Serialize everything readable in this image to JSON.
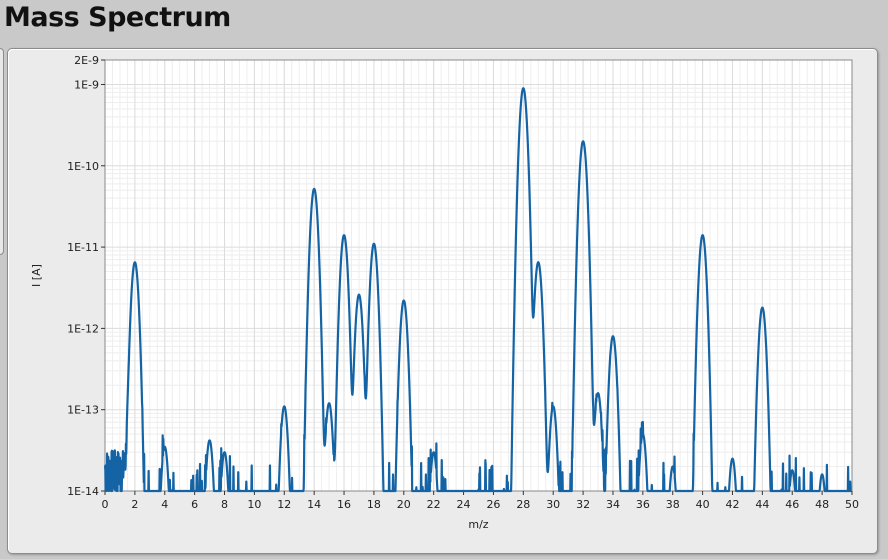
{
  "page": {
    "title": "Mass Spectrum"
  },
  "colors": {
    "trace": "#1463a5",
    "plot_bg": "#ffffff",
    "grid_major": "#dcdcdc",
    "grid_minor": "#eeeeee",
    "panel": "#ebebeb"
  },
  "chart_data": {
    "type": "line",
    "xlabel": "m/z",
    "ylabel": "I [A]",
    "xlim": [
      0,
      50
    ],
    "ylim": [
      1e-14,
      2e-09
    ],
    "y_scale": "log",
    "grid": true,
    "x_ticks": [
      0,
      2,
      4,
      6,
      8,
      10,
      12,
      14,
      16,
      18,
      20,
      22,
      24,
      26,
      28,
      30,
      32,
      34,
      36,
      38,
      40,
      42,
      44,
      46,
      48,
      50
    ],
    "y_ticks": [
      {
        "value": 1e-14,
        "label": "1E-14"
      },
      {
        "value": 1e-13,
        "label": "1E-13"
      },
      {
        "value": 1e-12,
        "label": "1E-12"
      },
      {
        "value": 1e-11,
        "label": "1E-11"
      },
      {
        "value": 1e-10,
        "label": "1E-10"
      },
      {
        "value": 1e-09,
        "label": "1E-9"
      },
      {
        "value": 2e-09,
        "label": "2E-9"
      }
    ],
    "peaks": [
      {
        "mz": 2,
        "intensity": 6.5e-12
      },
      {
        "mz": 4,
        "intensity": 3.5e-14
      },
      {
        "mz": 7,
        "intensity": 4.2e-14
      },
      {
        "mz": 8,
        "intensity": 3e-14
      },
      {
        "mz": 12,
        "intensity": 1.1e-13
      },
      {
        "mz": 14,
        "intensity": 5.2e-11
      },
      {
        "mz": 15,
        "intensity": 1.2e-13
      },
      {
        "mz": 16,
        "intensity": 1.4e-11
      },
      {
        "mz": 17,
        "intensity": 2.6e-12
      },
      {
        "mz": 18,
        "intensity": 1.1e-11
      },
      {
        "mz": 20,
        "intensity": 2.2e-12
      },
      {
        "mz": 22,
        "intensity": 3e-14
      },
      {
        "mz": 28,
        "intensity": 9e-10
      },
      {
        "mz": 29,
        "intensity": 6.5e-12
      },
      {
        "mz": 30,
        "intensity": 1.1e-13
      },
      {
        "mz": 32,
        "intensity": 2e-10
      },
      {
        "mz": 33,
        "intensity": 1.6e-13
      },
      {
        "mz": 34,
        "intensity": 8e-13
      },
      {
        "mz": 36,
        "intensity": 5e-14
      },
      {
        "mz": 38,
        "intensity": 2e-14
      },
      {
        "mz": 40,
        "intensity": 1.4e-11
      },
      {
        "mz": 42,
        "intensity": 2.5e-14
      },
      {
        "mz": 44,
        "intensity": 1.8e-12
      },
      {
        "mz": 46,
        "intensity": 1.8e-14
      },
      {
        "mz": 48,
        "intensity": 1.6e-14
      }
    ]
  }
}
